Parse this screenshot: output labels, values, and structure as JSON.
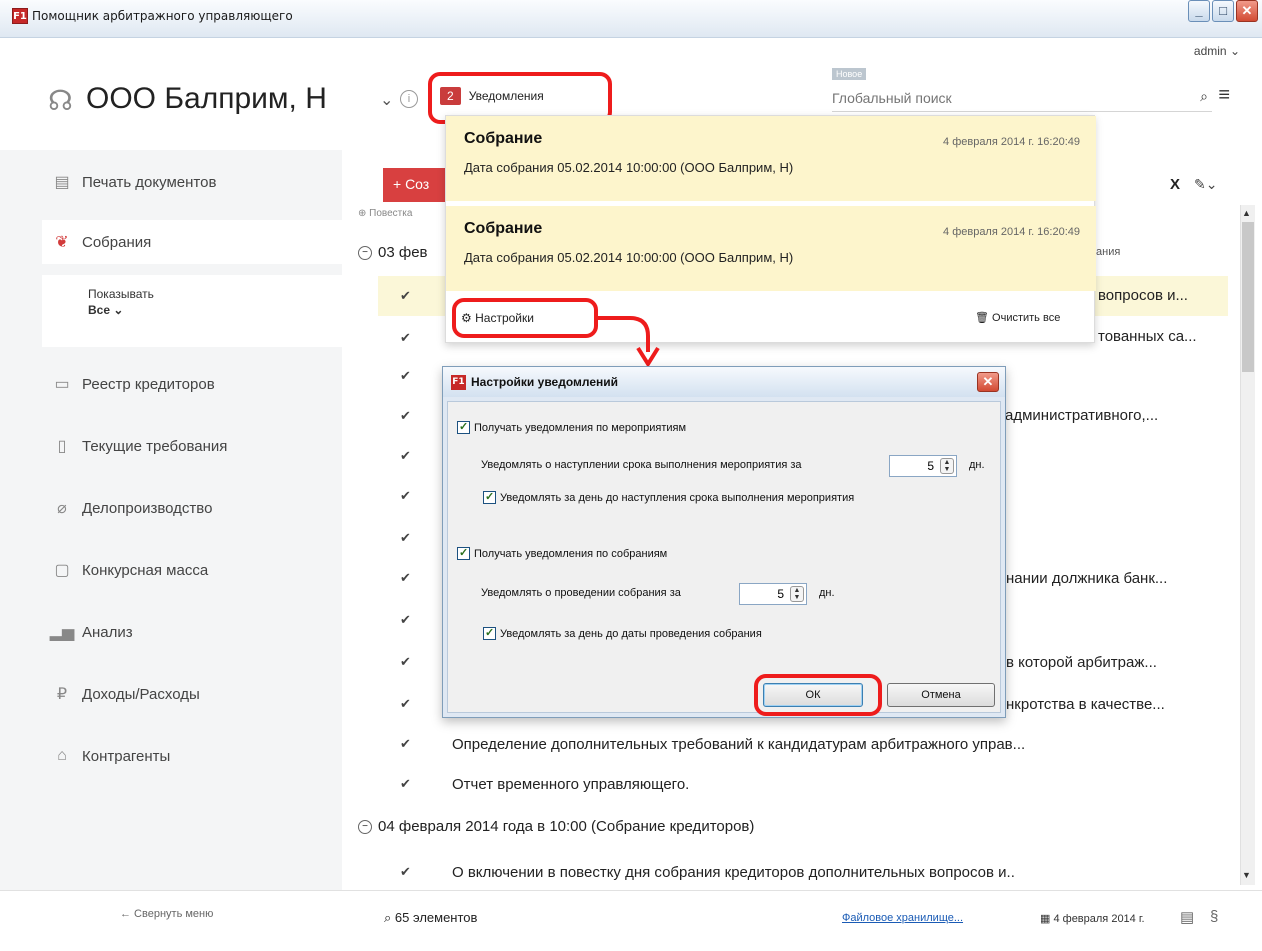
{
  "window": {
    "title": "Помощник арбитражного управляющего",
    "user": "admin ⌄"
  },
  "header": {
    "org_name": "ООО Балприм, Н",
    "notifications_count": "2",
    "notifications_label": "Уведомления",
    "new_badge": "Новое",
    "search_placeholder": "Глобальный поиск"
  },
  "sidebar": {
    "items": [
      {
        "label": "Печать документов"
      },
      {
        "label": "Собрания"
      },
      {
        "label": "Реестр кредиторов"
      },
      {
        "label": "Текущие требования"
      },
      {
        "label": "Делопроизводство"
      },
      {
        "label": "Конкурсная масса"
      },
      {
        "label": "Анализ"
      },
      {
        "label": "Доходы/Расходы"
      },
      {
        "label": "Контрагенты"
      }
    ],
    "show_label": "Показывать",
    "show_value": "Все ⌄",
    "collapse": "← Свернуть меню"
  },
  "main": {
    "create_label": "+ Соз",
    "agenda_label": "Повестка",
    "group1_head": "03 фев",
    "group1_tail": "ания",
    "rows": [
      {
        "text": "",
        "tail": "вопросов и..."
      },
      {
        "text": "",
        "tail": "тованных са..."
      },
      {
        "text": "",
        "tail": ""
      },
      {
        "text": "",
        "tail": "(административного,..."
      },
      {
        "text": "",
        "tail": ""
      },
      {
        "text": "",
        "tail": ""
      },
      {
        "text": "",
        "tail": ""
      },
      {
        "text": "",
        "tail": "нании должника банк..."
      },
      {
        "text": "",
        "tail": ""
      },
      {
        "text": "",
        "tail": "в которой арбитраж..."
      },
      {
        "text": "",
        "tail": "нкротства в качестве..."
      },
      {
        "text": "Определение дополнительных требований к кандидатурам арбитражного управ...",
        "tail": ""
      },
      {
        "text": "Отчет временного управляющего.",
        "tail": ""
      }
    ],
    "group2_head": "04 февраля 2014 года в 10:00 (Собрание кредиторов)",
    "row_last": "О включении в повестку дня собрания кредиторов дополнительных вопросов и..",
    "close_x": "X"
  },
  "notifications": [
    {
      "title": "Собрание",
      "date": "4 февраля 2014 г. 16:20:49",
      "body": "Дата собрания 05.02.2014 10:00:00 (ООО Балприм, Н)"
    },
    {
      "title": "Собрание",
      "date": "4 февраля 2014 г. 16:20:49",
      "body": "Дата собрания 05.02.2014 10:00:00 (ООО Балприм, Н)"
    }
  ],
  "popup": {
    "settings": "Настройки",
    "clear_all": "Очистить все"
  },
  "dialog": {
    "title": "Настройки уведомлений",
    "cb_events": "Получать уведомления по мероприятиям",
    "events_days_label": "Уведомлять о наступлении срока выполнения мероприятия за",
    "events_days_value": "5",
    "unit1": "дн.",
    "cb_events_day_before": "Уведомлять за день до наступления срока выполнения мероприятия",
    "cb_meetings": "Получать уведомления по собраниям",
    "meetings_days_label": "Уведомлять о проведении собрания за",
    "meetings_days_value": "5",
    "unit2": "дн.",
    "cb_meetings_day_before": "Уведомлять за день до даты проведения собрания",
    "ok": "ОК",
    "cancel": "Отмена"
  },
  "footer": {
    "items_count": "65 элементов",
    "file_storage": "Файловое хранилище...",
    "date": "4 февраля 2014 г."
  }
}
